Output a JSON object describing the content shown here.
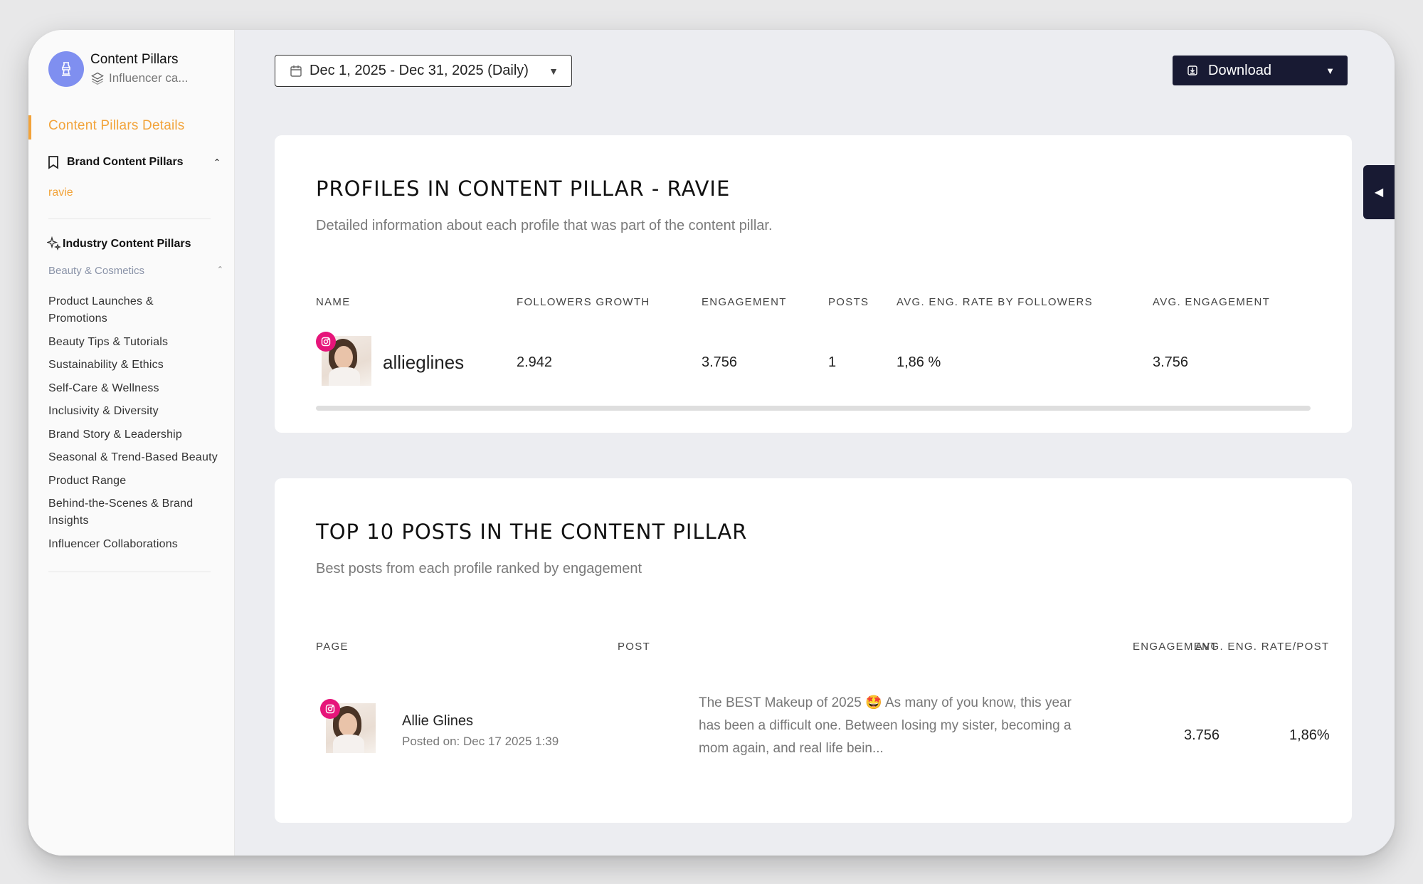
{
  "app": {
    "title": "Content Pillars",
    "subtitle": "Influencer ca..."
  },
  "sidebar": {
    "details_label": "Content Pillars Details",
    "brand_section": "Brand Content Pillars",
    "brand_items": [
      "ravie"
    ],
    "industry_section": "Industry Content Pillars",
    "industry_category": "Beauty & Cosmetics",
    "industry_items": [
      "Product Launches & Promotions",
      "Beauty Tips & Tutorials",
      "Sustainability & Ethics",
      "Self-Care & Wellness",
      "Inclusivity & Diversity",
      "Brand Story & Leadership",
      "Seasonal & Trend-Based Beauty",
      "Product Range",
      "Behind-the-Scenes & Brand Insights",
      "Influencer Collaborations"
    ]
  },
  "toolbar": {
    "date_range": "Dec 1, 2025 - Dec 31, 2025 (Daily)",
    "download_label": "Download"
  },
  "profiles_card": {
    "title": "PROFILES IN CONTENT PILLAR - RAVIE",
    "subtitle": "Detailed information about each profile that was part of the content pillar.",
    "columns": [
      "NAME",
      "FOLLOWERS GROWTH",
      "ENGAGEMENT",
      "POSTS",
      "AVG. ENG. RATE BY FOLLOWERS",
      "AVG. ENGAGEMENT"
    ],
    "rows": [
      {
        "name": "allieglines",
        "followers_growth": "2.942",
        "engagement": "3.756",
        "posts": "1",
        "avg_eng_rate": "1,86 %",
        "avg_engagement": "3.756"
      }
    ]
  },
  "posts_card": {
    "title": "TOP 10 POSTS IN THE CONTENT PILLAR",
    "subtitle": "Best posts from each profile ranked by engagement",
    "columns": [
      "PAGE",
      "POST",
      "ENGAGEMENT",
      "AVG. ENG. RATE/POST"
    ],
    "rows": [
      {
        "page_name": "Allie Glines",
        "posted_on": "Posted on: Dec 17 2025 1:39",
        "post_text": "The BEST Makeup of 2025 🤩 As many of you know, this year has been a difficult one. Between losing my sister, becoming a mom again, and real life bein...",
        "engagement": "3.756",
        "avg_eng_rate": "1,86%"
      }
    ]
  },
  "colors": {
    "accent": "#f2a33a",
    "dark_button": "#181a33",
    "instagram": "#e6157a",
    "logo_bg": "#7f8ff0"
  }
}
